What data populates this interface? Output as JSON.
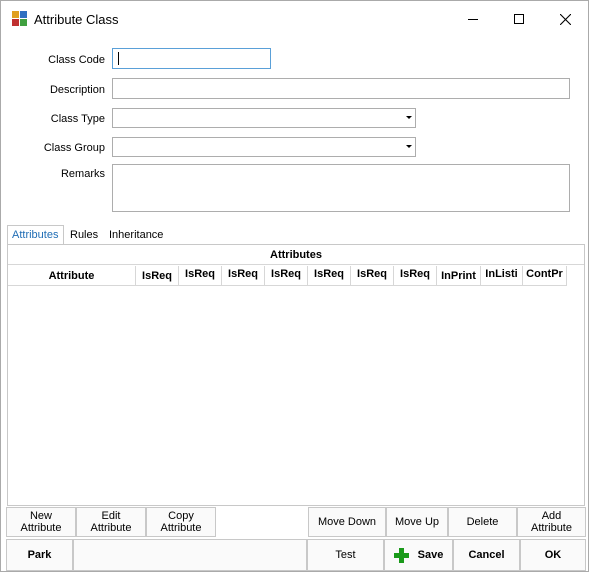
{
  "window": {
    "title": "Attribute Class"
  },
  "icons": {
    "app": "app-icon",
    "minimize": "minimize-icon",
    "maximize": "maximize-icon",
    "close": "close-icon",
    "combo_arrow": "chevron-down-icon",
    "save": "plus-icon"
  },
  "colors": {
    "accent": "#1f6db5",
    "save_icon": "#1a9a1a",
    "focus_border": "#5aa0d8"
  },
  "form": {
    "class_code": {
      "label": "Class Code",
      "value": ""
    },
    "description": {
      "label": "Description",
      "value": ""
    },
    "class_type": {
      "label": "Class Type",
      "value": ""
    },
    "class_group": {
      "label": "Class Group",
      "value": ""
    },
    "remarks": {
      "label": "Remarks",
      "value": ""
    }
  },
  "tabs": [
    {
      "label": "Attributes"
    },
    {
      "label": "Rules"
    },
    {
      "label": "Inheritance"
    }
  ],
  "grid": {
    "band": "Attributes",
    "columns": [
      "Attribute",
      "IsReq",
      "IsReq",
      "IsReq",
      "IsReq",
      "IsReq",
      "IsReq",
      "IsReq",
      "InPrint",
      "InListi",
      "ContPr"
    ]
  },
  "buttons": {
    "new_attribute": "New\nAttribute",
    "edit_attribute": "Edit\nAttribute",
    "copy_attribute": "Copy\nAttribute",
    "move_down": "Move Down",
    "move_up": "Move Up",
    "delete": "Delete",
    "add_attribute": "Add\nAttribute",
    "park": "Park",
    "test": "Test",
    "save": "Save",
    "cancel": "Cancel",
    "ok": "OK"
  }
}
